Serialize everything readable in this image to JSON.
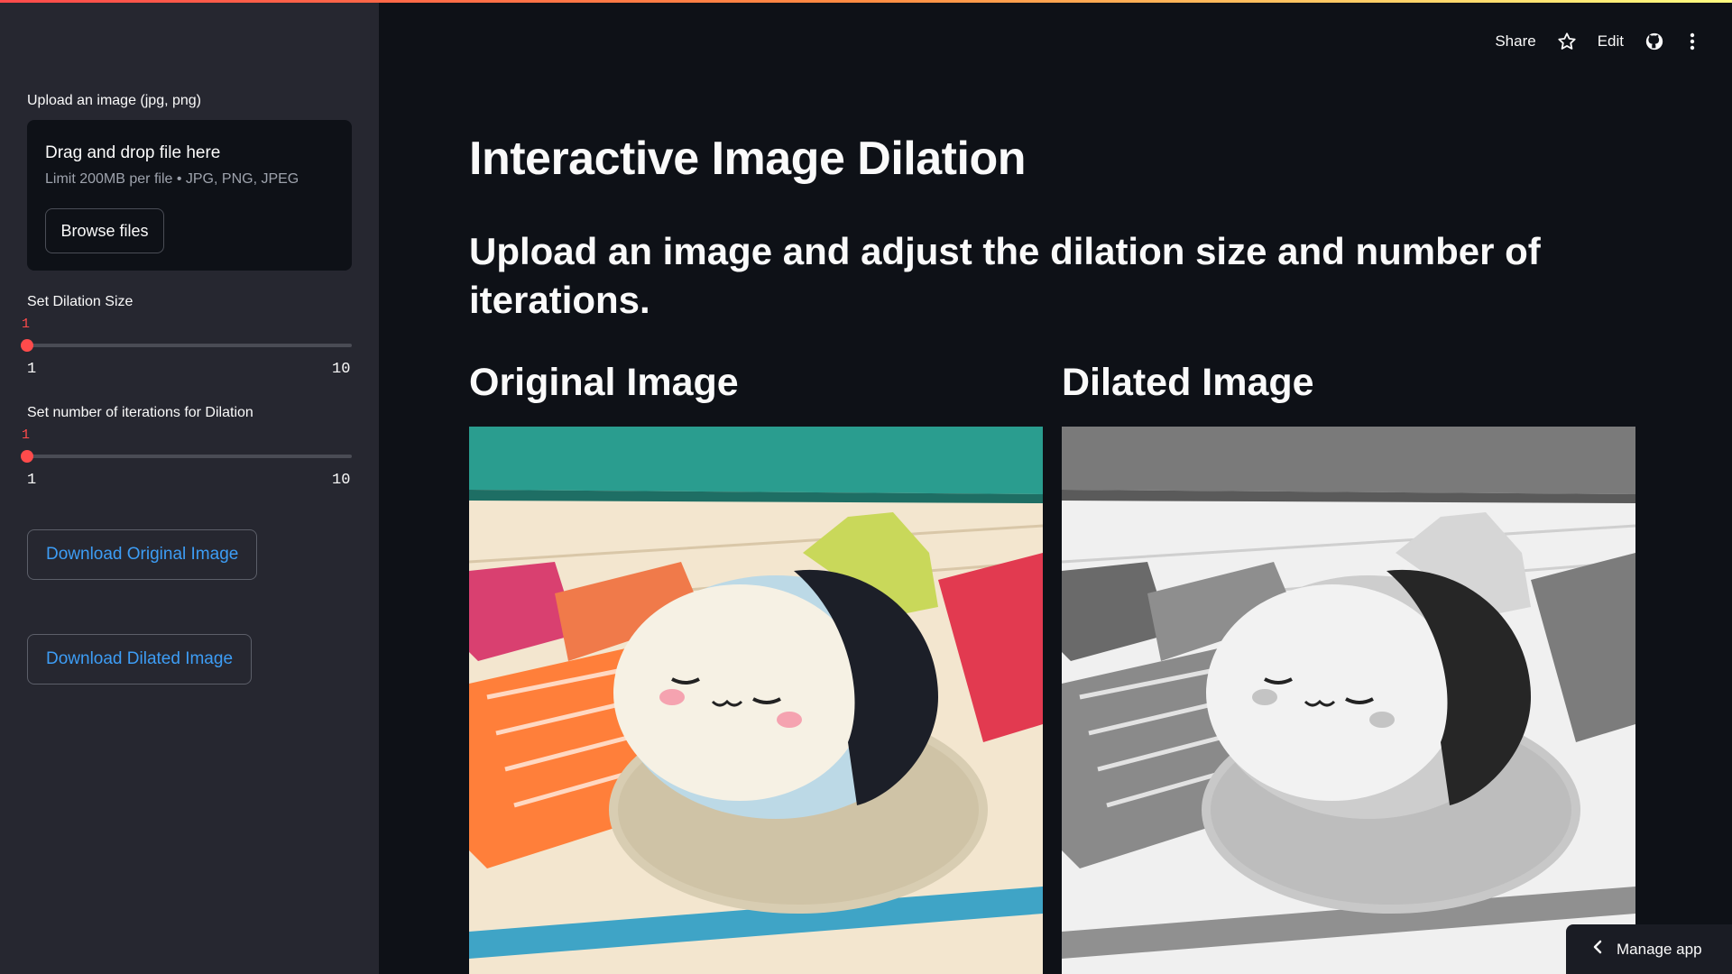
{
  "sidebar": {
    "upload_label": "Upload an image (jpg, png)",
    "dropzone_title": "Drag and drop file here",
    "dropzone_limit": "Limit 200MB per file • JPG, PNG, JPEG",
    "browse_label": "Browse files",
    "dilation_slider": {
      "label": "Set Dilation Size",
      "value": "1",
      "min": "1",
      "max": "10"
    },
    "iterations_slider": {
      "label": "Set number of iterations for Dilation",
      "value": "1",
      "min": "1",
      "max": "10"
    },
    "download_original_label": "Download Original Image",
    "download_dilated_label": "Download Dilated Image"
  },
  "toolbar": {
    "share_label": "Share",
    "edit_label": "Edit",
    "icons": [
      "star-icon",
      "github-icon",
      "more-vert-icon"
    ]
  },
  "main": {
    "title": "Interactive Image Dilation",
    "subtitle": "Upload an image and adjust the dilation size and number of iterations.",
    "original_heading": "Original Image",
    "dilated_heading": "Dilated Image"
  },
  "manage_app": {
    "label": "Manage app",
    "icon": "chevron-left-icon"
  },
  "colors": {
    "accent": "#ff4b4b",
    "link": "#3d9df5",
    "sidebar_bg": "#262730",
    "main_bg": "#0e1117"
  }
}
